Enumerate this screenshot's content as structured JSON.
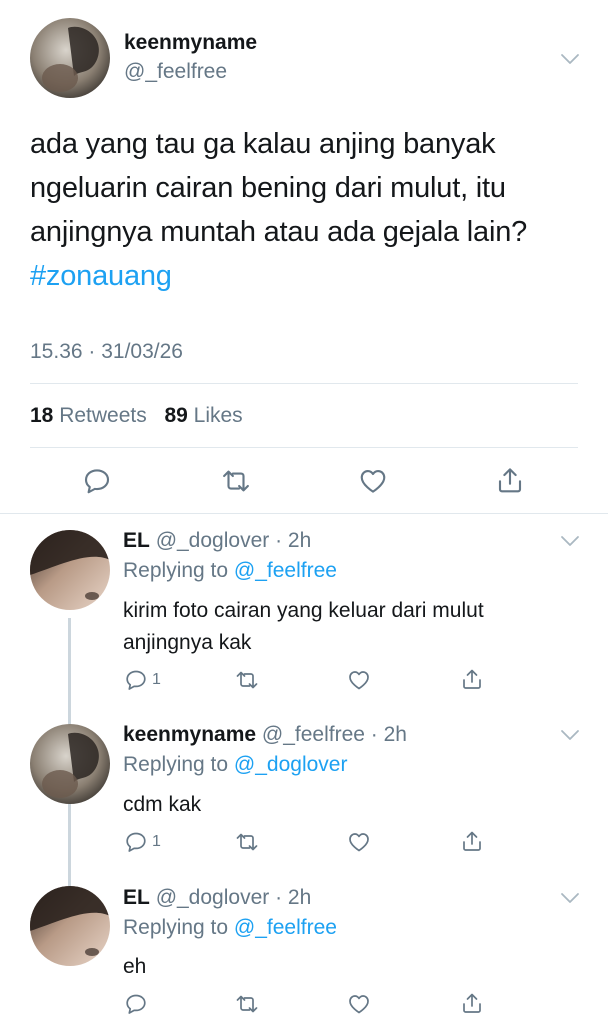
{
  "main_tweet": {
    "display_name": "keenmyname",
    "handle": "@_feelfree",
    "text": "ada yang tau ga kalau anjing banyak ngeluarin cairan bening dari mulut, itu anjingnya muntah atau ada gejala lain?",
    "hashtag": "#zonauang",
    "timestamp": "15.36 · 31/03/26",
    "retweets_count": "18",
    "retweets_label": "Retweets",
    "likes_count": "89",
    "likes_label": "Likes"
  },
  "replies": [
    {
      "display_name": "EL",
      "handle_time": "@_doglover · 2h",
      "replying_prefix": "Replying to",
      "replying_to": "@_feelfree",
      "text": "kirim foto cairan yang keluar dari mulut anjingnya kak",
      "reply_count": "1"
    },
    {
      "display_name": "keenmyname",
      "handle_time": "@_feelfree · 2h",
      "replying_prefix": "Replying to",
      "replying_to": "@_doglover",
      "text": "cdm kak",
      "reply_count": "1"
    },
    {
      "display_name": "EL",
      "handle_time": "@_doglover · 2h",
      "replying_prefix": "Replying to",
      "replying_to": "@_feelfree",
      "text": "eh",
      "reply_count": ""
    }
  ],
  "colors": {
    "link": "#1da1f2",
    "muted": "#657786",
    "divider": "#e1e8ed",
    "text": "#14171a"
  },
  "icons": [
    "reply-icon",
    "retweet-icon",
    "like-icon",
    "share-icon",
    "chevron-down-icon"
  ]
}
